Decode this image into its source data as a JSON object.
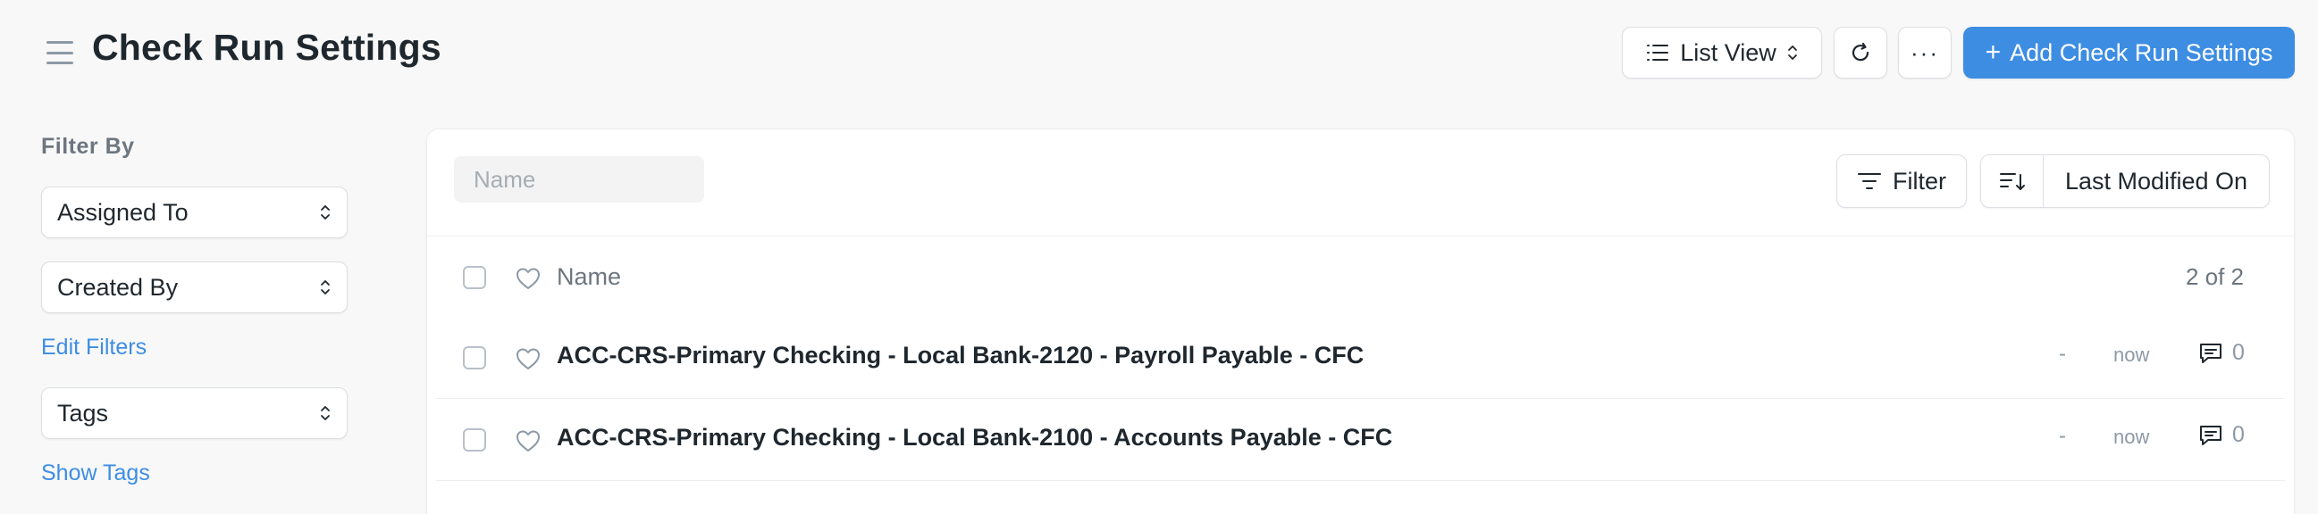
{
  "header": {
    "title": "Check Run Settings",
    "list_view_label": "List View",
    "more_label": "···",
    "primary_plus": "+",
    "primary_label": "Add Check Run Settings"
  },
  "sidebar": {
    "filter_heading": "Filter By",
    "assigned_to": "Assigned To",
    "created_by": "Created By",
    "edit_filters": "Edit Filters",
    "tags": "Tags",
    "show_tags": "Show Tags"
  },
  "list": {
    "search_placeholder": "Name",
    "filter_label": "Filter",
    "sort_field": "Last Modified On",
    "name_header": "Name",
    "count": "2 of 2",
    "rows": [
      {
        "name": "ACC-CRS-Primary Checking - Local Bank-2120 - Payroll Payable - CFC",
        "dash": "-",
        "modified": "now",
        "comments": "0"
      },
      {
        "name": "ACC-CRS-Primary Checking - Local Bank-2100 - Accounts Payable - CFC",
        "dash": "-",
        "modified": "now",
        "comments": "0"
      }
    ]
  },
  "colors": {
    "primary": "#3d8de3",
    "text": "#1f272e",
    "muted": "#6c7680",
    "background": "#f8f8f8"
  }
}
